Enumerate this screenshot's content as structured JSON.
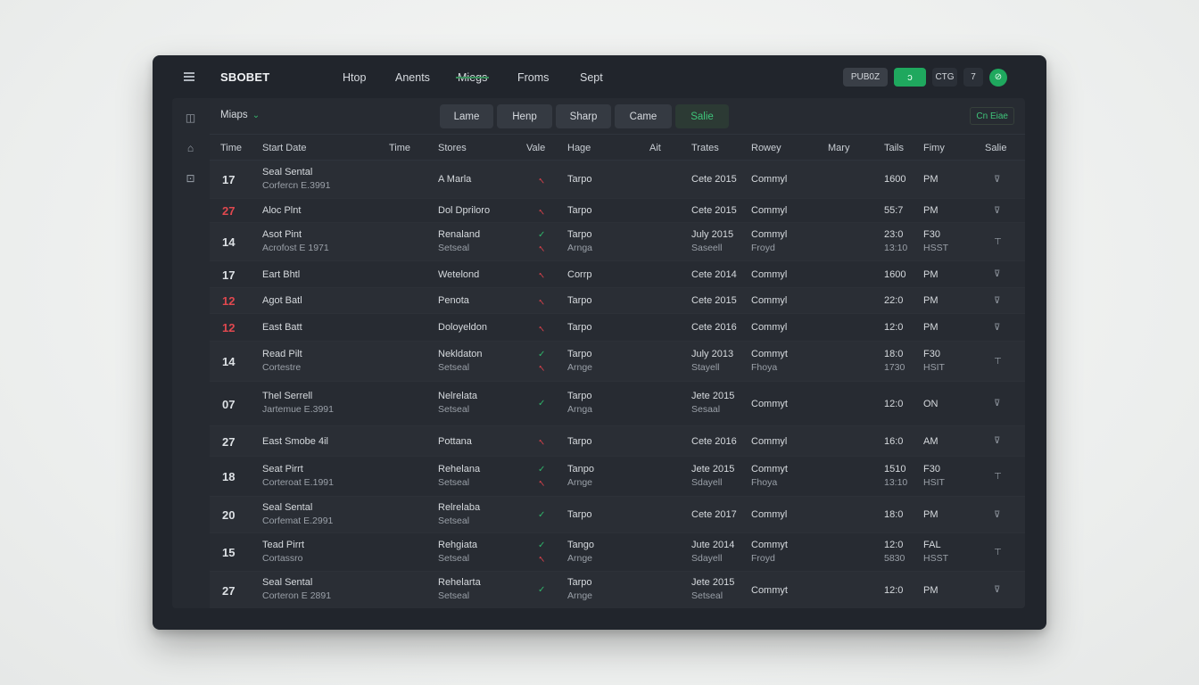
{
  "app": {
    "brand": "SBOBET"
  },
  "nav": [
    {
      "label": "Htop",
      "active": false
    },
    {
      "label": "Anents",
      "active": false
    },
    {
      "label": "Miegs",
      "active": true
    },
    {
      "label": "Froms",
      "active": false
    },
    {
      "label": "Sept",
      "active": false
    }
  ],
  "topright": {
    "pill1": "PUB0Z",
    "pill2": "ↄ",
    "pill3": "CTG",
    "pill4": "7",
    "avatar": "⊘"
  },
  "siderail": [
    {
      "icon": "chart-icon",
      "glyph": "◫"
    },
    {
      "icon": "home-icon",
      "glyph": "⌂"
    },
    {
      "icon": "bag-icon",
      "glyph": "⊡"
    }
  ],
  "toolbar": {
    "filter_label": "Miaps",
    "filter_chevron": "⌄",
    "segments": [
      "Lame",
      "Henp",
      "Sharp",
      "Came",
      "Salie"
    ],
    "right_action": "Cn Eiae"
  },
  "columns": [
    "Time",
    "Start Date",
    "Time",
    "Stores",
    "Vale",
    "Hage",
    "Ait",
    "Trates",
    "Rowey",
    "Mary",
    "Tails",
    "Fimy",
    "Salie"
  ],
  "rows": [
    {
      "num": "17",
      "red": false,
      "s1": "Seal Sental",
      "s2": "Corfercn E.3991",
      "st1": "A Marla",
      "st2": "",
      "v1": "down",
      "v2": "",
      "h1": "Tarpo",
      "h2": "",
      "d1": "Cete 2015",
      "d2": "",
      "r1": "Commyl",
      "r2": "",
      "t1": "1600",
      "t2": "",
      "f1": "PM",
      "f2": "",
      "a": "⊽"
    },
    {
      "num": "27",
      "red": true,
      "s1": "Aloc Plnt",
      "s2": "",
      "st1": "Dol Dpriloro",
      "st2": "",
      "v1": "down",
      "v2": "",
      "h1": "Tarpo",
      "h2": "",
      "d1": "Cete 2015",
      "d2": "",
      "r1": "Commyl",
      "r2": "",
      "t1": "55:7",
      "t2": "",
      "f1": "PM",
      "f2": "",
      "a": "⊽"
    },
    {
      "num": "14",
      "red": false,
      "s1": "Asot Pint",
      "s2": "Acrofost E 1971",
      "st1": "Renaland",
      "st2": "Setseal",
      "v1": "up",
      "v2": "down",
      "h1": "Tarpo",
      "h2": "Arnga",
      "d1": "July 2015",
      "d2": "Saseell",
      "r1": "Commyl",
      "r2": "Froyd",
      "t1": "23:0",
      "t2": "13:10",
      "f1": "F30",
      "f2": "HSST",
      "a": "⊤"
    },
    {
      "num": "17",
      "red": false,
      "s1": "Eart Bhtl",
      "s2": "",
      "st1": "Wetelond",
      "st2": "",
      "v1": "down",
      "v2": "",
      "h1": "Corrp",
      "h2": "",
      "d1": "Cete 2014",
      "d2": "",
      "r1": "Commyl",
      "r2": "",
      "t1": "1600",
      "t2": "",
      "f1": "PM",
      "f2": "",
      "a": "⊽"
    },
    {
      "num": "12",
      "red": true,
      "s1": "Agot Batl",
      "s2": "",
      "st1": "Penota",
      "st2": "",
      "v1": "down",
      "v2": "",
      "h1": "Tarpo",
      "h2": "",
      "d1": "Cete 2015",
      "d2": "",
      "r1": "Commyl",
      "r2": "",
      "t1": "22:0",
      "t2": "",
      "f1": "PM",
      "f2": "",
      "a": "⊽"
    },
    {
      "num": "12",
      "red": true,
      "s1": "East Batt",
      "s2": "",
      "st1": "Doloyeldon",
      "st2": "",
      "v1": "down",
      "v2": "",
      "h1": "Tarpo",
      "h2": "",
      "d1": "Cete 2016",
      "d2": "",
      "r1": "Commyl",
      "r2": "",
      "t1": "12:0",
      "t2": "",
      "f1": "PM",
      "f2": "",
      "a": "⊽"
    },
    {
      "num": "14",
      "red": false,
      "s1": "Read Pilt",
      "s2": "Cortestre",
      "st1": "Nekldaton",
      "st2": "Setseal",
      "v1": "up",
      "v2": "down",
      "h1": "Tarpo",
      "h2": "Arnge",
      "d1": "July 2013",
      "d2": "Stayell",
      "r1": "Commyt",
      "r2": "Fhoya",
      "t1": "18:0",
      "t2": "1730",
      "f1": "F30",
      "f2": "HSIT",
      "a": "⊤"
    },
    {
      "num": "07",
      "red": false,
      "s1": "Thel Serrell",
      "s2": "Jartemue E.3991",
      "st1": "Nelrelata",
      "st2": "Setseal",
      "v1": "up",
      "v2": "",
      "h1": "Tarpo",
      "h2": "Arnga",
      "d1": "Jete 2015",
      "d2": "Sesaal",
      "r1": "Commyt",
      "r2": "",
      "t1": "12:0",
      "t2": "",
      "f1": "ON",
      "f2": "",
      "a": "⊽"
    },
    {
      "num": "27",
      "red": false,
      "s1": "East Smobe 4il",
      "s2": "",
      "st1": "Pottana",
      "st2": "",
      "v1": "down",
      "v2": "",
      "h1": "Tarpo",
      "h2": "",
      "d1": "Cete 2016",
      "d2": "",
      "r1": "Commyl",
      "r2": "",
      "t1": "16:0",
      "t2": "",
      "f1": "AM",
      "f2": "",
      "a": "⊽"
    },
    {
      "num": "18",
      "red": false,
      "s1": "Seat Pirrt",
      "s2": "Corteroat E.1991",
      "st1": "Rehelana",
      "st2": "Setseal",
      "v1": "up",
      "v2": "down",
      "h1": "Tanpo",
      "h2": "Arnge",
      "d1": "Jete 2015",
      "d2": "Sdayell",
      "r1": "Commyt",
      "r2": "Fhoya",
      "t1": "1510",
      "t2": "13:10",
      "f1": "F30",
      "f2": "HSIT",
      "a": "⊤"
    },
    {
      "num": "20",
      "red": false,
      "s1": "Seal Sental",
      "s2": "Corfemat E.2991",
      "st1": "Relrelaba",
      "st2": "Setseal",
      "v1": "up",
      "v2": "",
      "h1": "Tarpo",
      "h2": "",
      "d1": "Cete 2017",
      "d2": "",
      "r1": "Commyl",
      "r2": "",
      "t1": "18:0",
      "t2": "",
      "f1": "PM",
      "f2": "",
      "a": "⊽"
    },
    {
      "num": "15",
      "red": false,
      "s1": "Tead Pirrt",
      "s2": "Cortassro",
      "st1": "Rehgiata",
      "st2": "Setseal",
      "v1": "up",
      "v2": "down",
      "h1": "Tango",
      "h2": "Arnge",
      "d1": "Jute 2014",
      "d2": "Sdayell",
      "r1": "Commyt",
      "r2": "Froyd",
      "t1": "12:0",
      "t2": "5830",
      "f1": "FAL",
      "f2": "HSST",
      "a": "⊤"
    },
    {
      "num": "27",
      "red": false,
      "s1": "Seal Sental",
      "s2": "Corteron E 2891",
      "st1": "Rehelarta",
      "st2": "Setseal",
      "v1": "up",
      "v2": "",
      "h1": "Tarpo",
      "h2": "Arnge",
      "d1": "Jete 2015",
      "d2": "Setseal",
      "r1": "Commyt",
      "r2": "",
      "t1": "12:0",
      "t2": "",
      "f1": "PM",
      "f2": "",
      "a": "⊽"
    }
  ]
}
